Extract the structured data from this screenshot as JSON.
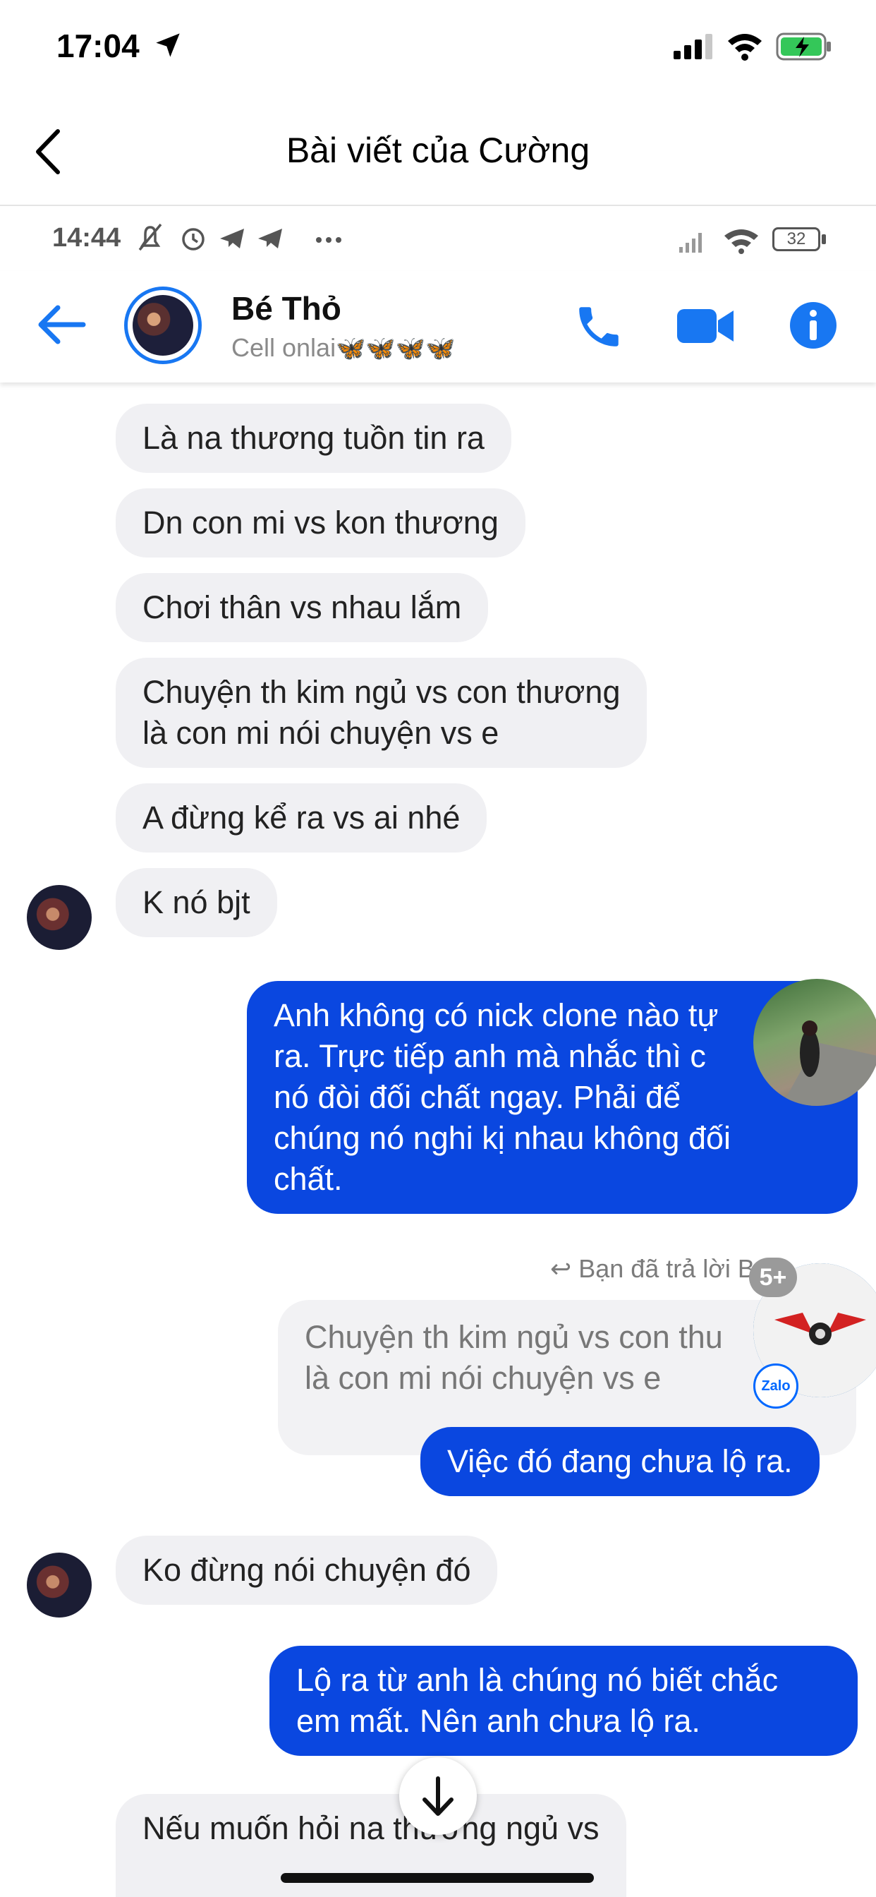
{
  "ios_status": {
    "time": "17:04"
  },
  "nav": {
    "title": "Bài viết của Cường"
  },
  "android_status": {
    "time": "14:44",
    "battery": "32"
  },
  "chat_header": {
    "name": "Bé Thỏ",
    "status": "Cell onlai"
  },
  "messages": [
    {
      "dir": "in",
      "lines": [
        "Là na thương tuồn tin ra"
      ]
    },
    {
      "dir": "in",
      "lines": [
        "Dn con mi vs kon thương"
      ]
    },
    {
      "dir": "in",
      "lines": [
        "Chơi thân vs nhau lắm"
      ]
    },
    {
      "dir": "in",
      "lines": [
        "Chuyện th kim ngủ vs con thương",
        "là con mi nói chuyện vs e"
      ]
    },
    {
      "dir": "in",
      "lines": [
        "A đừng kể ra vs ai nhé"
      ]
    },
    {
      "dir": "in",
      "lines": [
        "K nó bjt"
      ]
    },
    {
      "dir": "out",
      "lines": [
        "Anh không có nick clone nào tự",
        "ra. Trực tiếp anh mà nhắc thì c",
        "nó đòi đối chất ngay. Phải để",
        "chúng nó nghi kị nhau không đối",
        "chất."
      ]
    },
    {
      "dir": "reply_label",
      "text": "Bạn đã trả lời B"
    },
    {
      "dir": "reply_quote",
      "lines": [
        "Chuyện th kim ngủ vs con thu",
        "là con mi nói chuyện vs e"
      ]
    },
    {
      "dir": "out",
      "lines": [
        "Việc đó đang chưa lộ ra."
      ]
    },
    {
      "dir": "in",
      "lines": [
        "Ko đừng nói chuyện đó"
      ]
    },
    {
      "dir": "out",
      "lines": [
        "Lộ ra từ anh là chúng nó biết chắc",
        "em mất. Nên anh chưa lộ ra."
      ]
    },
    {
      "dir": "in",
      "lines": [
        "Nếu muốn hỏi na thương ngủ vs"
      ]
    }
  ],
  "overlay": {
    "badge": "5+",
    "zalo_label": "Zalo"
  },
  "colors": {
    "messenger_blue": "#1877f2",
    "outgoing_bubble": "#0a47e0",
    "incoming_bubble": "#f0f0f3"
  }
}
